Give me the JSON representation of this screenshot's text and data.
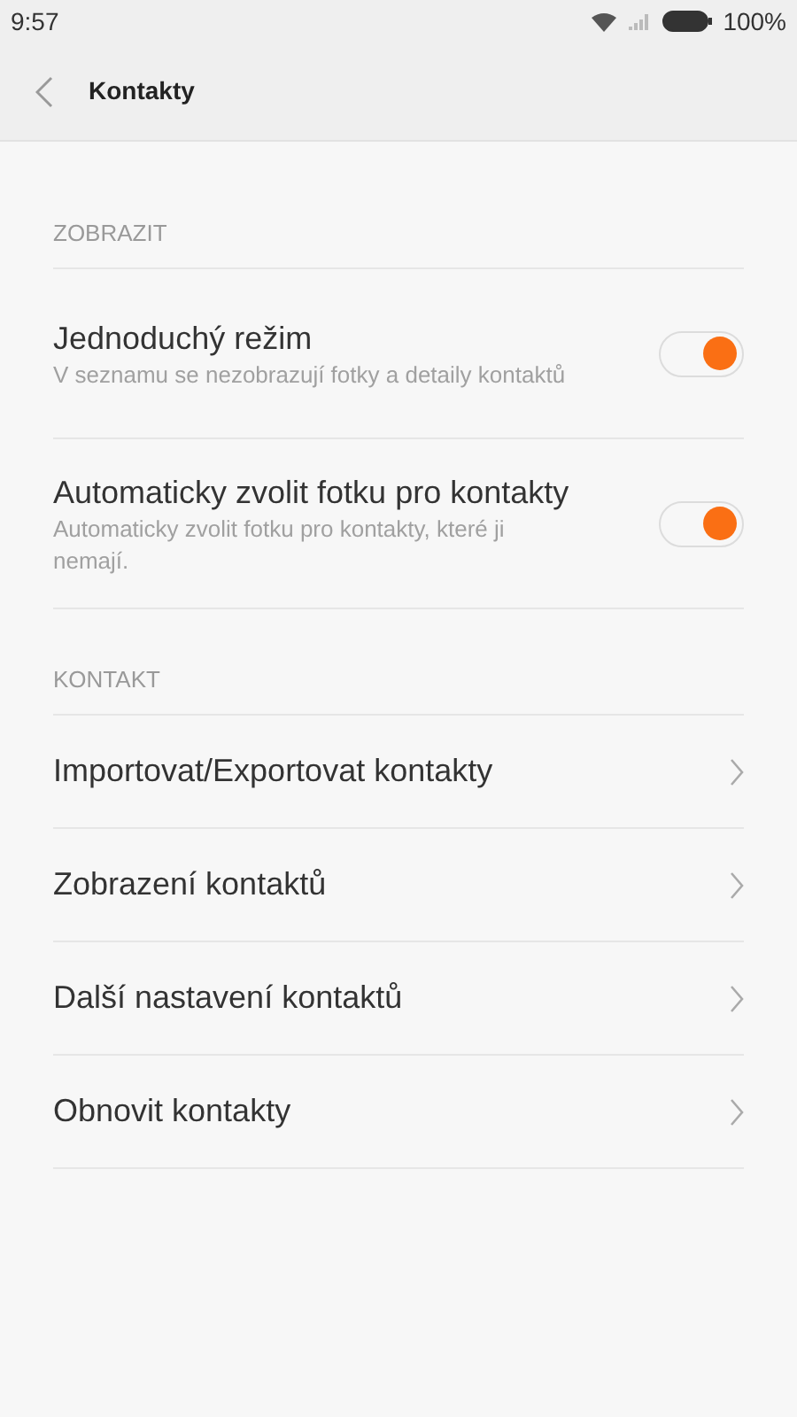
{
  "status_bar": {
    "time": "9:57",
    "battery": "100%"
  },
  "header": {
    "title": "Kontakty"
  },
  "sections": [
    {
      "title": "ZOBRAZIT",
      "items": [
        {
          "kind": "toggle",
          "label": "Jednoduchý režim",
          "description": "V seznamu se nezobrazují fotky a detaily kontaktů",
          "on": true
        },
        {
          "kind": "toggle",
          "label": "Automaticky zvolit fotku pro kontakty",
          "description": "Automaticky zvolit fotku pro kontakty, které ji nemají.",
          "on": true
        }
      ]
    },
    {
      "title": "KONTAKT",
      "items": [
        {
          "kind": "link",
          "label": "Importovat/Exportovat kontakty"
        },
        {
          "kind": "link",
          "label": "Zobrazení kontaktů"
        },
        {
          "kind": "link",
          "label": "Další nastavení kontaktů"
        },
        {
          "kind": "link",
          "label": "Obnovit kontakty"
        }
      ]
    }
  ]
}
